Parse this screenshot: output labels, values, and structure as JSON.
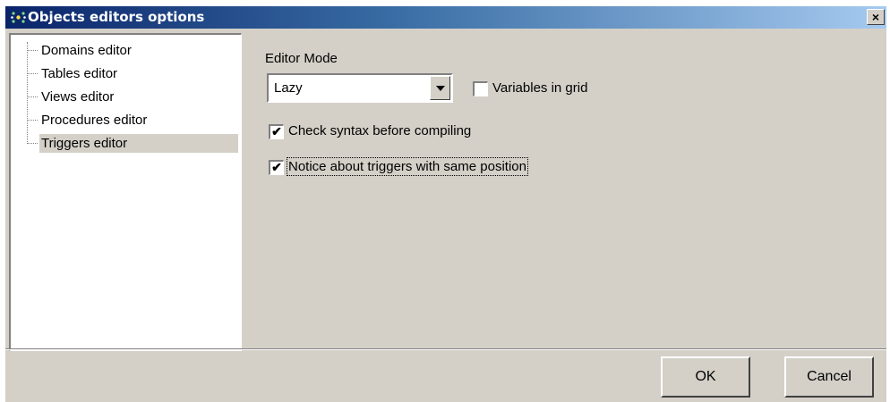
{
  "window": {
    "title": "Objects editors options",
    "close_label": "×"
  },
  "tree": {
    "items": [
      {
        "label": "Domains editor",
        "selected": false
      },
      {
        "label": "Tables editor",
        "selected": false
      },
      {
        "label": "Views editor",
        "selected": false
      },
      {
        "label": "Procedures editor",
        "selected": false
      },
      {
        "label": "Triggers editor",
        "selected": true
      }
    ]
  },
  "settings": {
    "editor_mode_label": "Editor Mode",
    "editor_mode_value": "Lazy",
    "variables_in_grid": {
      "label": "Variables in grid",
      "checked": false
    },
    "check_syntax": {
      "label": "Check syntax before compiling",
      "checked": true
    },
    "notice_triggers": {
      "label": "Notice about triggers with same position",
      "checked": true
    },
    "check_mark": "✔"
  },
  "buttons": {
    "ok": "OK",
    "cancel": "Cancel"
  },
  "colors": {
    "title_start": "#0a246a",
    "title_end": "#a6caf0",
    "face": "#d4d0c8"
  }
}
